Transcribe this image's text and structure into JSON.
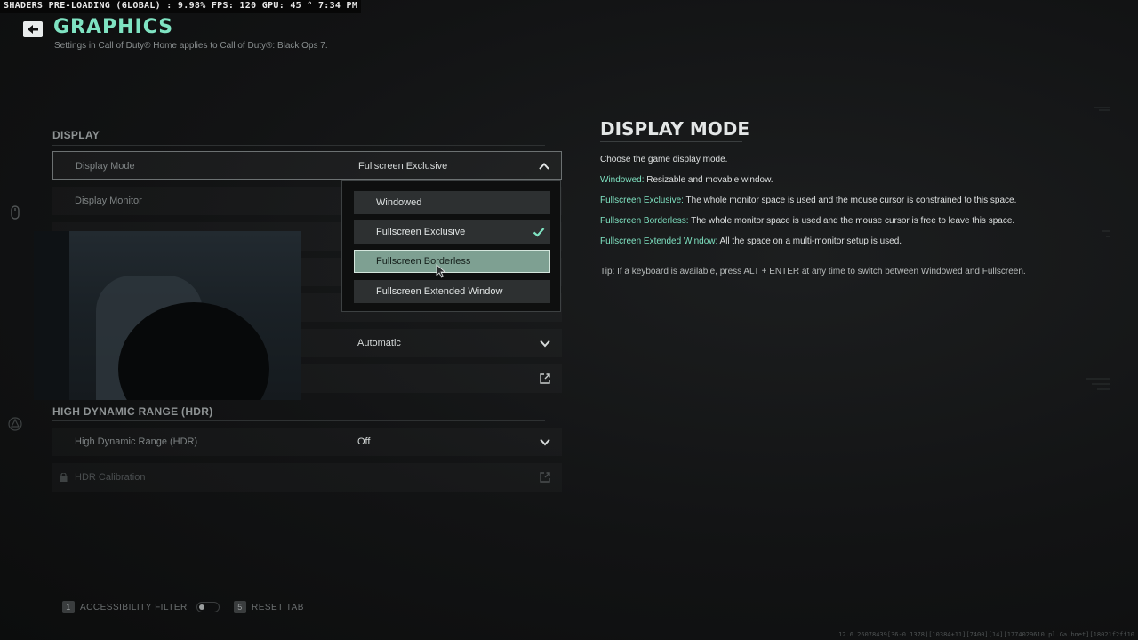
{
  "overlay": {
    "text": "SHADERS PRE-LOADING (GLOBAL) : 9.98% FPS: 120  GPU: 45 °  7:34 PM"
  },
  "header": {
    "title": "GRAPHICS",
    "subtitle": "Settings in Call of Duty® Home applies to Call of Duty®: Black Ops 7."
  },
  "sections": {
    "display": "DISPLAY",
    "hdr": "HIGH DYNAMIC RANGE (HDR)"
  },
  "rows": {
    "display_mode": {
      "label": "Display Mode",
      "value": "Fullscreen Exclusive"
    },
    "display_monitor": {
      "label": "Display Monitor"
    },
    "hidden_row_value": "Automatic",
    "hdr": {
      "label": "High Dynamic Range (HDR)",
      "value": "Off"
    },
    "hdr_calibration": {
      "label": "HDR Calibration"
    }
  },
  "dropdown": {
    "options": [
      "Windowed",
      "Fullscreen Exclusive",
      "Fullscreen Borderless",
      "Fullscreen Extended Window"
    ],
    "selected": "Fullscreen Exclusive",
    "hovered": "Fullscreen Borderless"
  },
  "info": {
    "title": "DISPLAY MODE",
    "description": "Choose the game display mode.",
    "items": [
      {
        "term": "Windowed:",
        "text": " Resizable and movable window."
      },
      {
        "term": "Fullscreen Exclusive:",
        "text": " The whole monitor space is used and the mouse cursor is constrained to this space."
      },
      {
        "term": "Fullscreen Borderless:",
        "text": " The whole monitor space is used and the mouse cursor is free to leave this space."
      },
      {
        "term": "Fullscreen Extended Window:",
        "text": " All the space on a multi-monitor setup is used."
      }
    ],
    "tip": "Tip: If a keyboard is available, press ALT + ENTER at any time to switch between Windowed and Fullscreen."
  },
  "footer": {
    "accessibility_key": "1",
    "accessibility_label": "ACCESSIBILITY FILTER",
    "reset_key": "5",
    "reset_label": "RESET TAB"
  },
  "build_string": "12.6.26078439[36-0.1378][10384+11][7400][14][1774029610.pl.Ga.bnet][18021f2ff10",
  "colors": {
    "accent": "#7fe3c2",
    "hover": "#7ea092"
  },
  "icons": [
    "back-arrow-icon",
    "chevron-up-icon",
    "chevron-down-icon",
    "external-link-icon",
    "check-icon",
    "lock-icon",
    "mouse-cursor-icon"
  ]
}
